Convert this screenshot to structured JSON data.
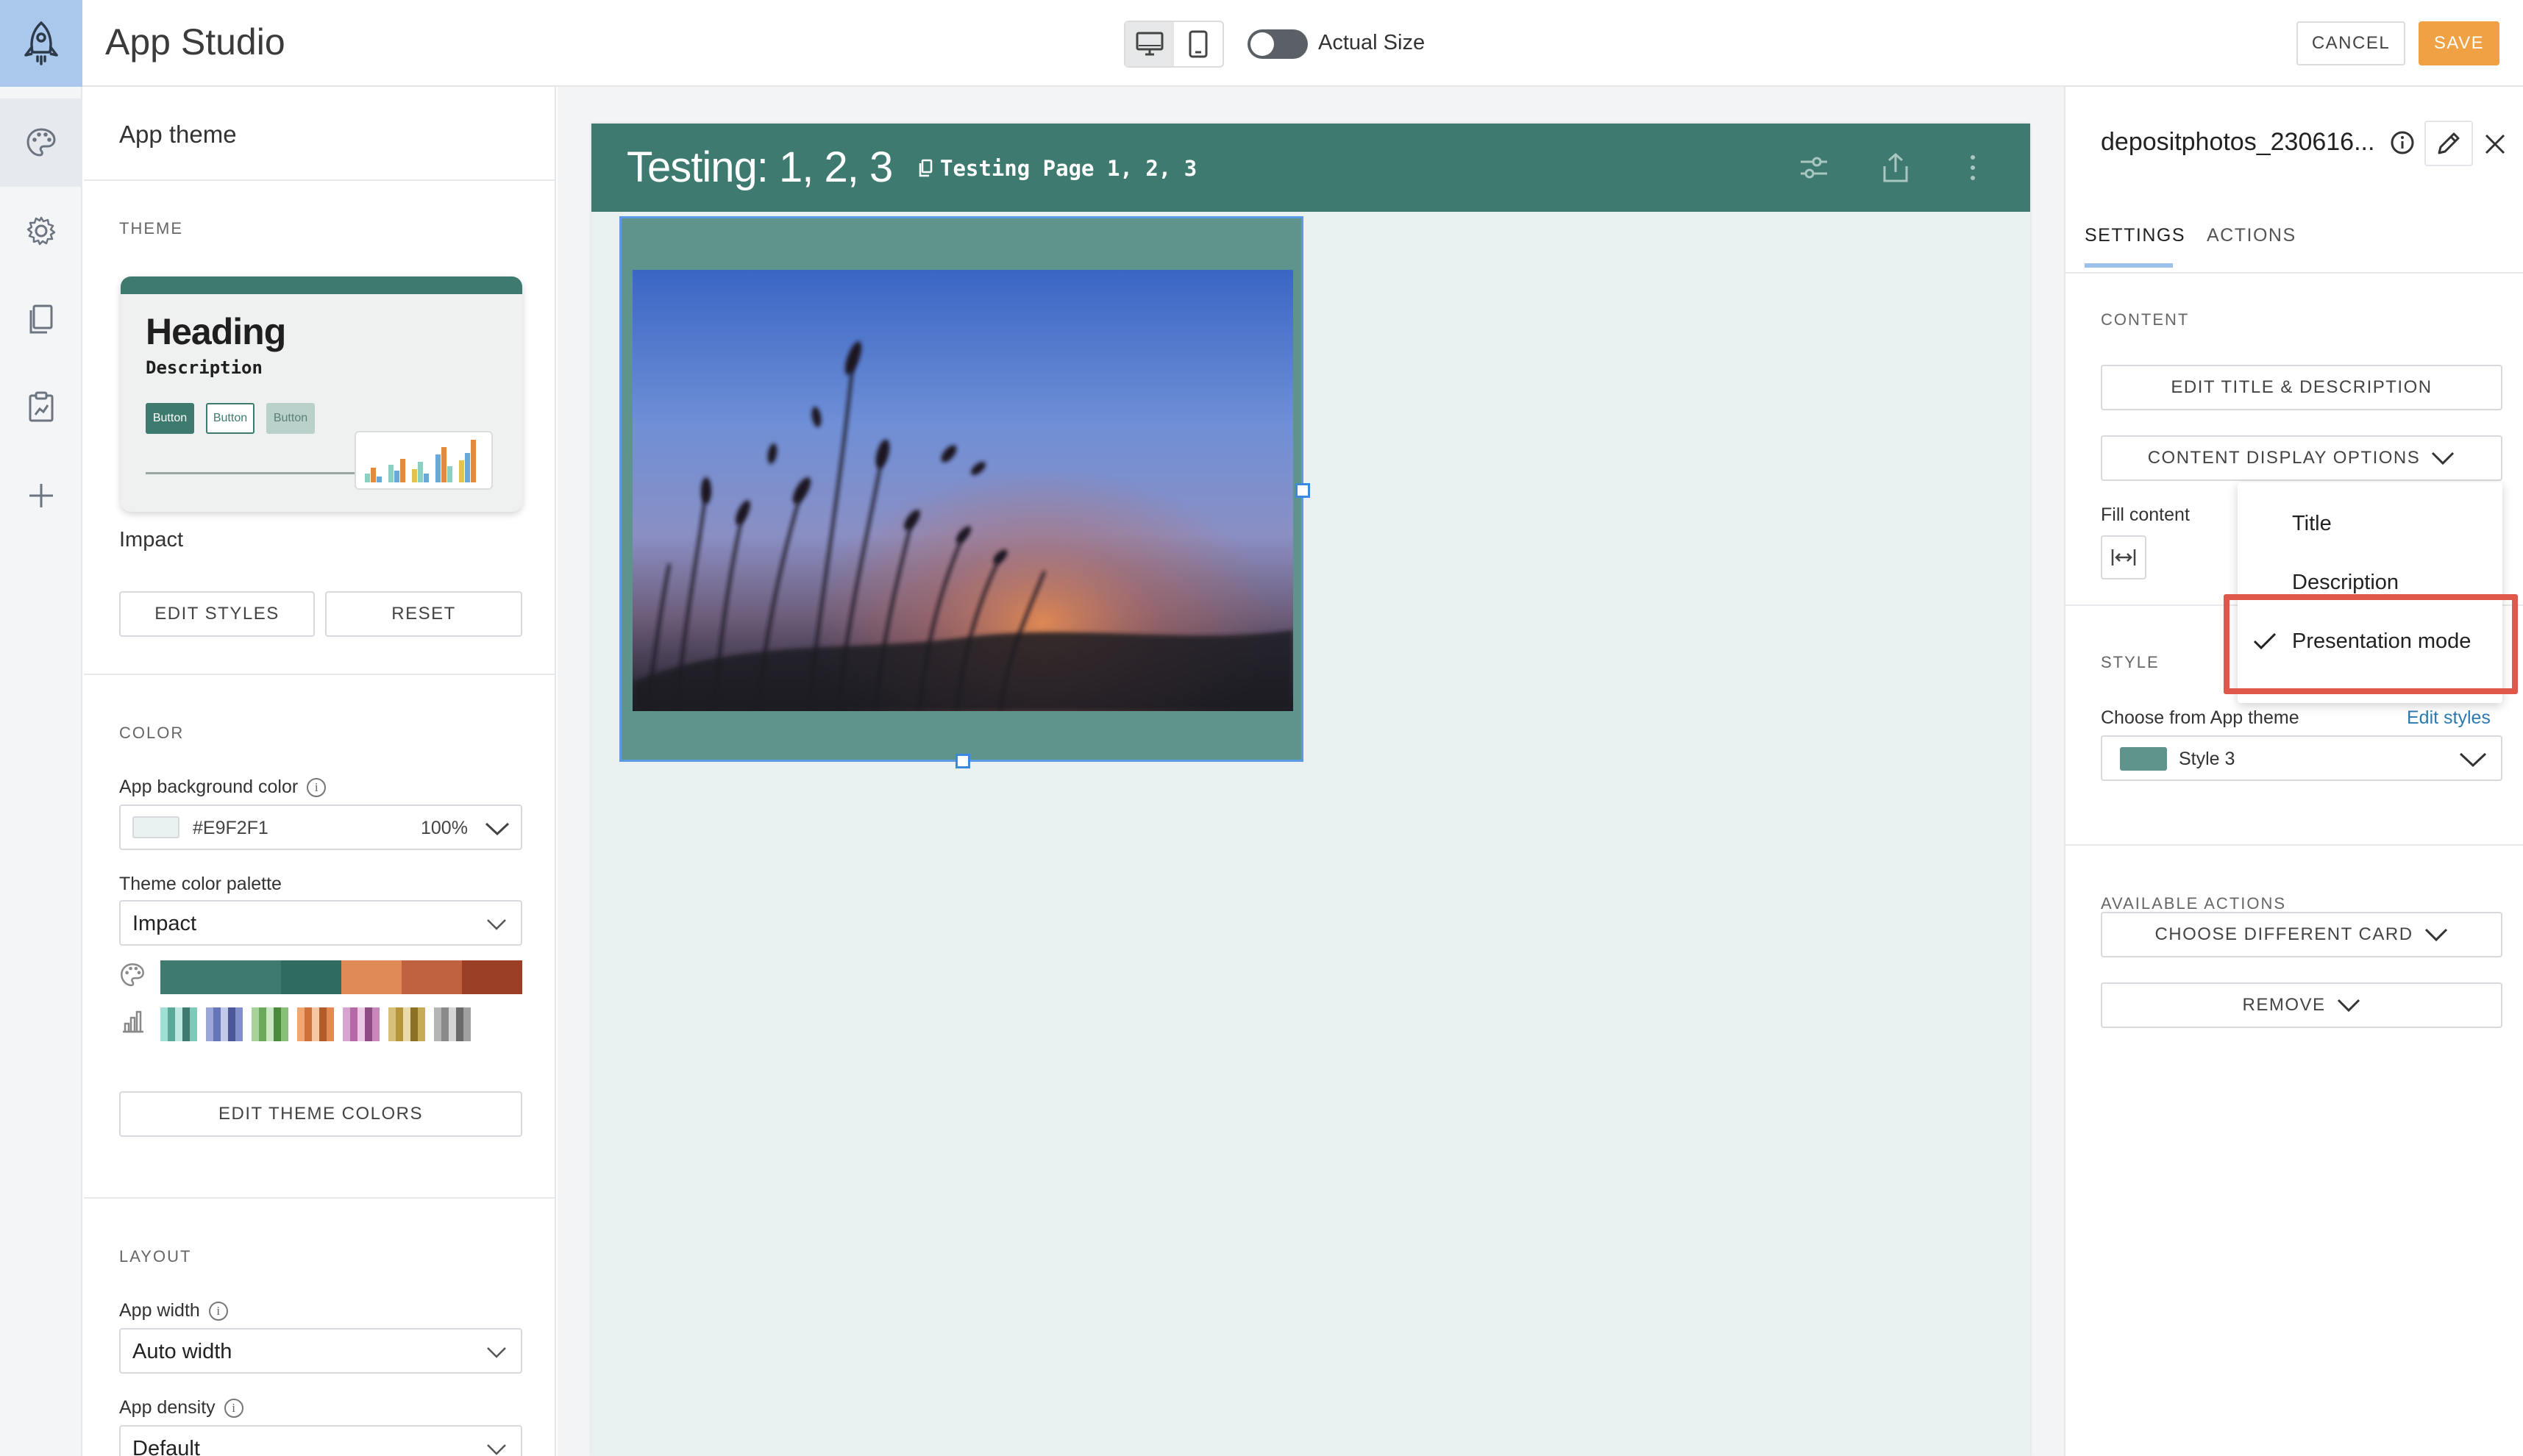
{
  "app": {
    "title": "App Studio",
    "actual_size_label": "Actual Size",
    "cancel_label": "CANCEL",
    "save_label": "SAVE",
    "accent_color": "#f0a143"
  },
  "rail": {
    "items": [
      "palette-icon",
      "gear-icon",
      "pages-icon",
      "clipboard-chart-icon",
      "plus-icon"
    ]
  },
  "left_panel": {
    "title": "App theme",
    "theme_section": "THEME",
    "preview": {
      "heading": "Heading",
      "description": "Description",
      "buttons": [
        "Button",
        "Button",
        "Button"
      ]
    },
    "theme_name": "Impact",
    "edit_styles_label": "EDIT STYLES",
    "reset_label": "RESET",
    "color_section": "COLOR",
    "bg_color_label": "App background color",
    "bg_color_value": "#E9F2F1",
    "bg_opacity": "100%",
    "palette_label": "Theme color palette",
    "palette_value": "Impact",
    "palette_colors": [
      "#3e7a6e",
      "#3e7a6e",
      "#2f6b5f",
      "#e08a55",
      "#c0623f",
      "#9a3e26"
    ],
    "edit_theme_colors_label": "EDIT THEME COLORS",
    "layout_section": "LAYOUT",
    "width_label": "App width",
    "width_value": "Auto width",
    "density_label": "App density",
    "density_value": "Default"
  },
  "canvas": {
    "page_title": "Testing: 1, 2, 3",
    "page_subtitle": "Testing Page 1, 2, 3",
    "page_bg": "#E9F2F1",
    "header_color": "#3f7a70"
  },
  "right_panel": {
    "title": "depositphotos_230616...",
    "tabs": [
      "SETTINGS",
      "ACTIONS"
    ],
    "content_section": "CONTENT",
    "edit_title_label": "EDIT TITLE & DESCRIPTION",
    "display_options_label": "CONTENT DISPLAY OPTIONS",
    "fill_content_label": "Fill content",
    "dropdown_items": [
      "Title",
      "Description",
      "Presentation mode"
    ],
    "style_section": "STYLE",
    "choose_theme_label": "Choose from App theme",
    "edit_styles_link": "Edit styles",
    "style_value": "Style 3",
    "available_actions_section": "AVAILABLE ACTIONS",
    "choose_card_label": "CHOOSE DIFFERENT CARD",
    "remove_label": "REMOVE"
  }
}
